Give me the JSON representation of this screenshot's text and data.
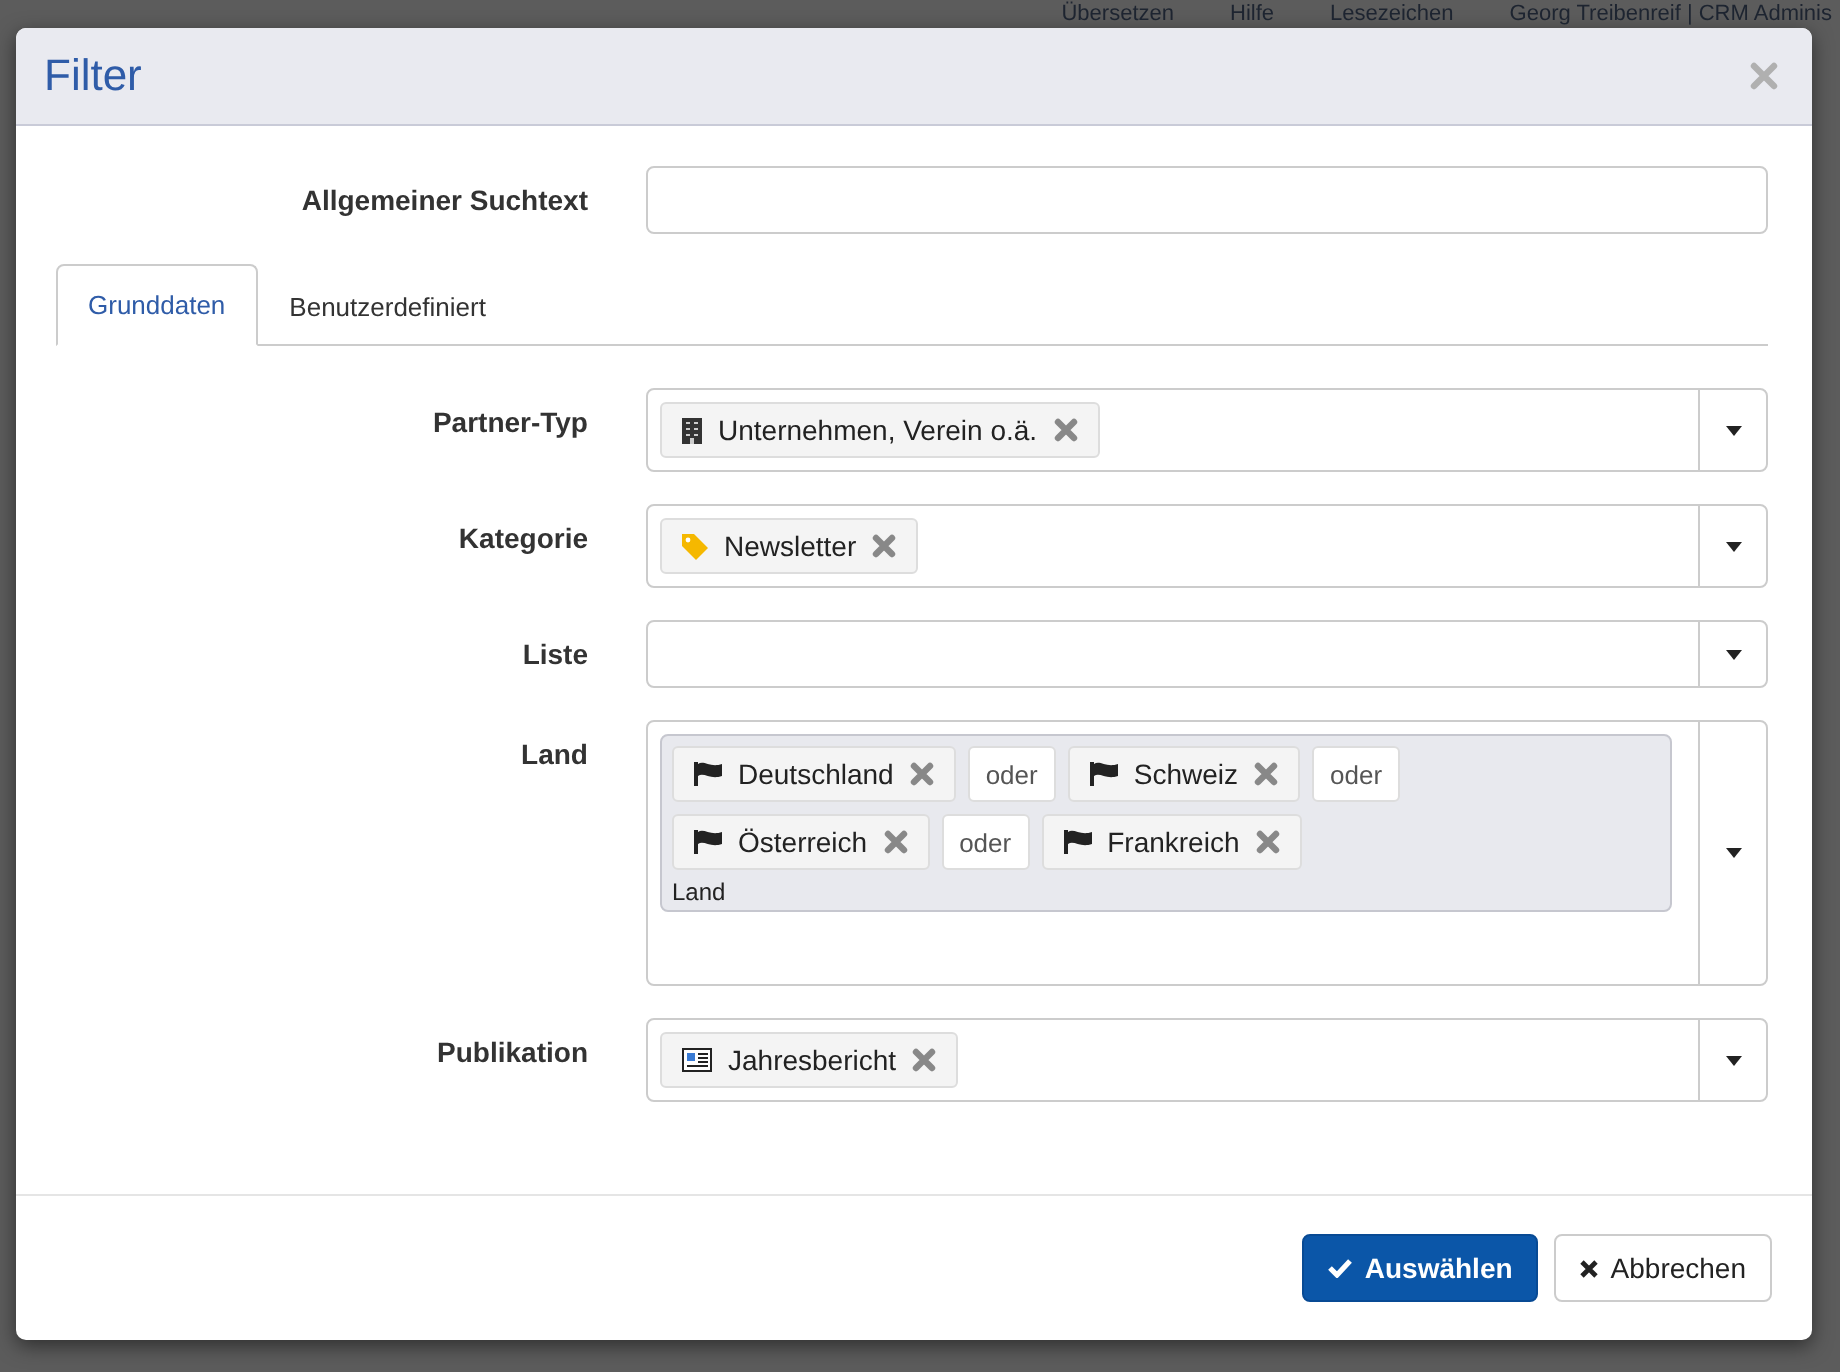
{
  "background_nav": [
    {
      "label": "Übersetzen"
    },
    {
      "label": "Hilfe"
    },
    {
      "label": "Lesezeichen"
    },
    {
      "label": "Georg Treibenreif | CRM Adminis"
    }
  ],
  "window": {
    "title": "Filter"
  },
  "search": {
    "label": "Allgemeiner Suchtext"
  },
  "tabs": [
    {
      "label": "Grunddaten",
      "selected": true
    },
    {
      "label": "Benutzerdefiniert",
      "selected": false
    }
  ],
  "fields": [
    {
      "label": "Partner-Typ",
      "tags": [
        {
          "kind": "building",
          "text": "Unternehmen, Verein o.ä."
        }
      ]
    },
    {
      "label": "Kategorie",
      "tags": [
        {
          "kind": "tag",
          "text": "Newsletter"
        }
      ]
    },
    {
      "label": "Liste"
    },
    {
      "label": "Land",
      "grouped": true,
      "placeholder": "Land",
      "tags": [
        {
          "kind": "flag",
          "text": "Deutschland"
        },
        {
          "kind": "connector",
          "text": "oder"
        },
        {
          "kind": "flag",
          "text": "Schweiz"
        },
        {
          "kind": "connector",
          "text": "oder"
        },
        {
          "kind": "flag",
          "text": "Österreich"
        },
        {
          "kind": "connector",
          "text": "oder"
        },
        {
          "kind": "flag",
          "text": "Frankreich"
        }
      ]
    },
    {
      "label": "Publikation",
      "tags": [
        {
          "kind": "newspaper",
          "text": "Jahresbericht"
        }
      ]
    }
  ],
  "buttons": [
    {
      "kind": "primary",
      "label": "Auswählen"
    },
    {
      "kind": "default",
      "label": "Abbrechen"
    }
  ]
}
